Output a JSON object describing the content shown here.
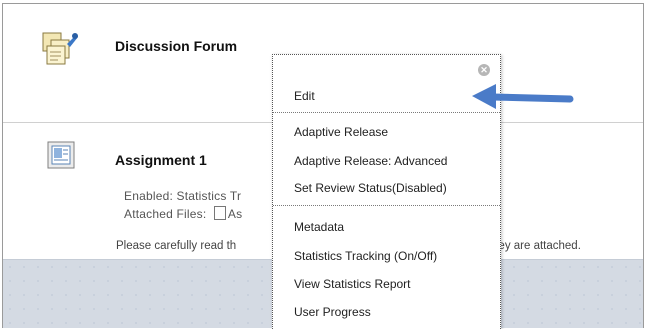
{
  "items": [
    {
      "title": "Discussion Forum",
      "icon": "discussion-forum-icon"
    },
    {
      "title": "Assignment 1",
      "icon": "assignment-icon",
      "enabled_label": "Enabled:",
      "enabled_value": "Statistics Tr",
      "attached_label": "Attached Files:",
      "attached_value": "As",
      "description_left": "Please carefully read th",
      "description_right": "They are attached."
    }
  ],
  "context_menu": {
    "close_icon": "close-circle-icon",
    "groups": [
      [
        "Edit"
      ],
      [
        "Adaptive Release",
        "Adaptive Release: Advanced",
        "Set Review Status(Disabled)"
      ],
      [
        "Metadata",
        "Statistics Tracking (On/Off)",
        "View Statistics Report",
        "User Progress"
      ]
    ]
  },
  "colors": {
    "arrow": "#4a7bc8",
    "bottom_band": "#d4dae3"
  }
}
